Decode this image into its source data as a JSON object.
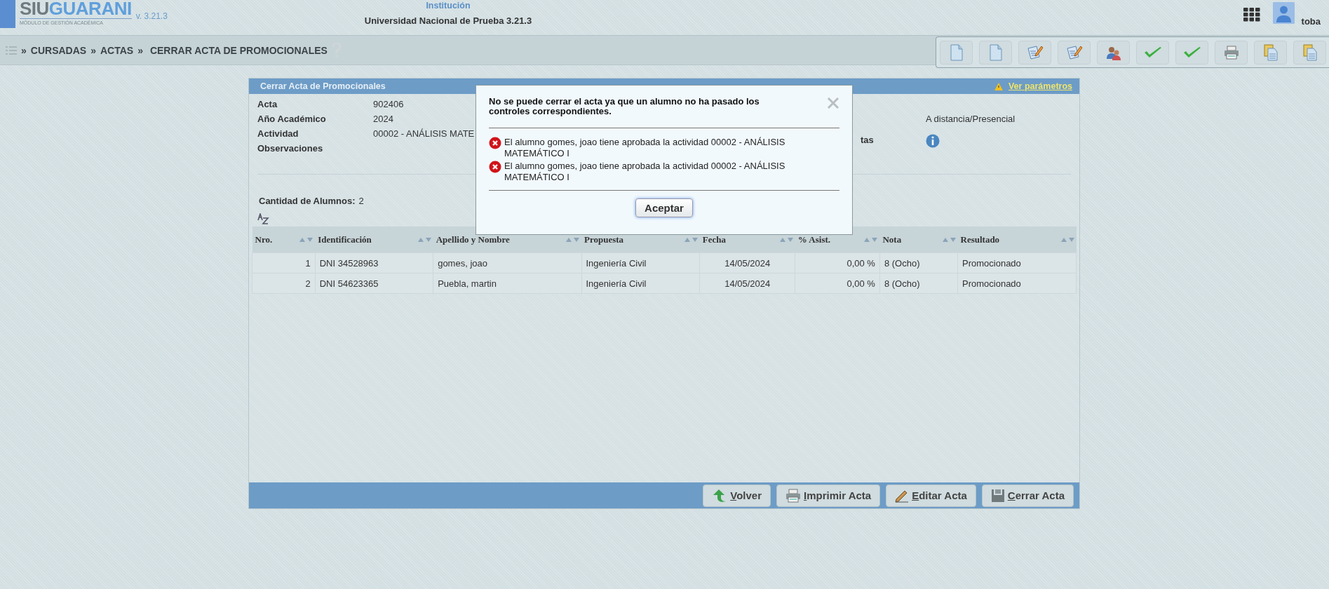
{
  "header": {
    "logo": {
      "prefix": "SIU",
      "name": "GUARANI",
      "subtitle": "MÓDULO DE GESTIÓN ACADÉMICA"
    },
    "version": "v. 3.21.3",
    "institution_label": "Institución",
    "institution": "Universidad Nacional de Prueba 3.21.3",
    "user": "toba"
  },
  "breadcrumb": {
    "separator": "»",
    "items": [
      "CURSADAS",
      "ACTAS"
    ],
    "current": "CERRAR ACTA DE PROMOCIONALES"
  },
  "panel": {
    "title": "Cerrar Acta de Promocionales",
    "params_link": "Ver parámetros",
    "fields": [
      {
        "label": "Acta",
        "value": "902406"
      },
      {
        "label": "Año Académico",
        "value": "2024"
      },
      {
        "label": "Actividad",
        "value": "00002 - ANÁLISIS MATE"
      },
      {
        "label": "Observaciones"
      }
    ],
    "right_fields": [
      {
        "kind": "text",
        "value": "A distancia/Presencial"
      },
      {
        "kind": "info",
        "label": "tas"
      }
    ],
    "count_label": "Cantidad de Alumnos:",
    "count": "2",
    "table": {
      "columns": [
        "Nro.",
        "Identificación",
        "Apellido y Nombre",
        "Propuesta",
        "Fecha",
        "% Asist.",
        "Nota",
        "Resultado"
      ],
      "rows": [
        [
          "1",
          "DNI 34528963",
          "gomes, joao",
          "Ingeniería Civil",
          "14/05/2024",
          "0,00 %",
          "8 (Ocho)",
          "Promocionado"
        ],
        [
          "2",
          "DNI 54623365",
          "Puebla, martin",
          "Ingeniería Civil",
          "14/05/2024",
          "0,00 %",
          "8 (Ocho)",
          "Promocionado"
        ]
      ]
    },
    "buttons": [
      {
        "kind": "back",
        "label": "Volver"
      },
      {
        "kind": "print",
        "label": "Imprimir Acta"
      },
      {
        "kind": "edit",
        "label": "Editar Acta"
      },
      {
        "kind": "save",
        "label": "Cerrar Acta"
      }
    ]
  },
  "dialog": {
    "title": "No se puede cerrar el acta ya que un alumno no ha pasado los controles correspondientes.",
    "messages": [
      "El alumno gomes, joao tiene aprobada la actividad 00002 - ANÁLISIS MATEMÁTICO I",
      "El alumno gomes, joao tiene aprobada la actividad 00002 - ANÁLISIS MATEMÁTICO I"
    ],
    "button": "Aceptar"
  }
}
